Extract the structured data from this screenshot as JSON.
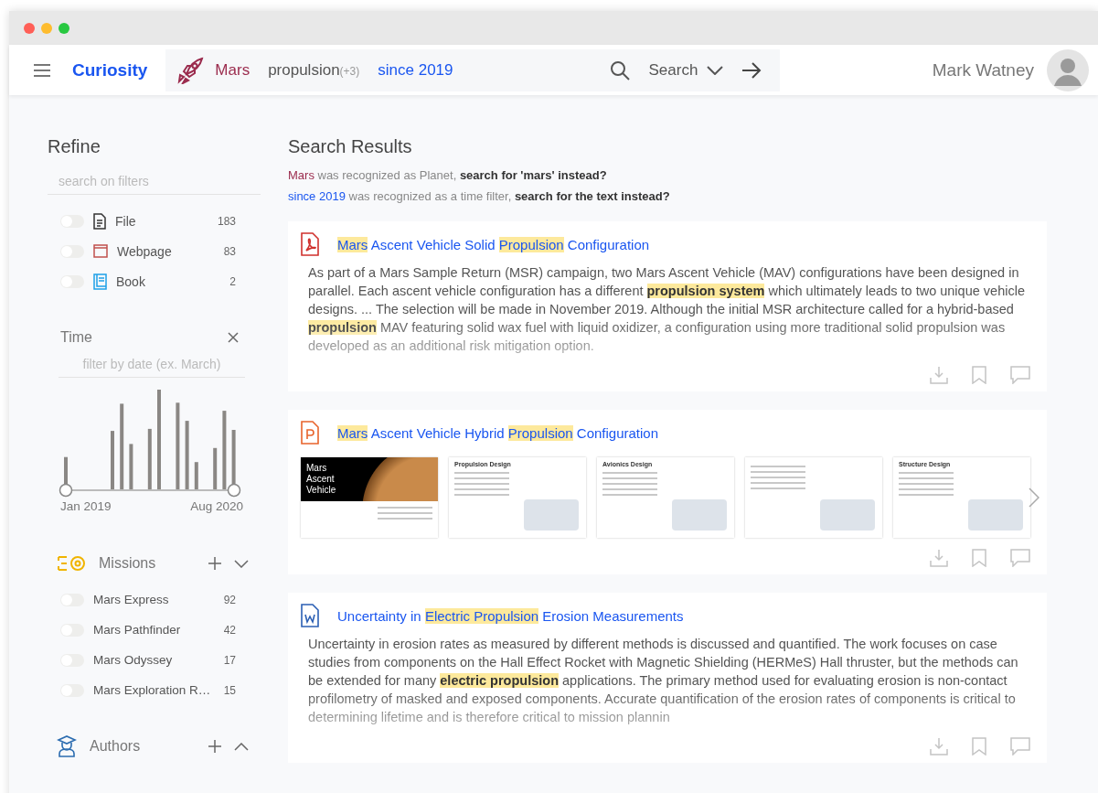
{
  "header": {
    "app_name": "Curiosity",
    "query_tokens": [
      {
        "kind": "entity",
        "text": "Mars"
      },
      {
        "kind": "term",
        "text": "propulsion",
        "extra": "(+3)"
      },
      {
        "kind": "time",
        "text": "since 2019"
      }
    ],
    "search_button": "Search",
    "user_name": "Mark Watney"
  },
  "refine": {
    "title": "Refine",
    "filter_placeholder": "search on filters",
    "types": [
      {
        "kind": "file",
        "label": "File",
        "count": "183",
        "on": false
      },
      {
        "kind": "webpage",
        "label": "Webpage",
        "count": "83",
        "on": false
      },
      {
        "kind": "book",
        "label": "Book",
        "count": "2",
        "on": false
      }
    ],
    "time": {
      "title": "Time",
      "placeholder": "filter by date (ex. March)",
      "start_label": "Jan 2019",
      "end_label": "Aug 2020"
    },
    "facets": [
      {
        "kind": "missions",
        "title": "Missions",
        "expanded": true,
        "items": [
          {
            "label": "Mars Express",
            "count": "92",
            "on": false
          },
          {
            "label": "Mars Pathfinder",
            "count": "42",
            "on": false
          },
          {
            "label": "Mars Odyssey",
            "count": "17",
            "on": false
          },
          {
            "label": "Mars Exploration R…",
            "count": "15",
            "on": false
          }
        ]
      },
      {
        "kind": "authors",
        "title": "Authors",
        "expanded": false
      }
    ]
  },
  "results": {
    "title": "Search Results",
    "notices": [
      {
        "kind": "entity",
        "entity": "Mars",
        "text": "was recognized as Planet,",
        "action": "search for 'mars' instead?"
      },
      {
        "kind": "time",
        "entity": "since 2019",
        "text": "was recognized as a time filter,",
        "action": "search for the text instead?"
      }
    ],
    "items": [
      {
        "kind": "pdf",
        "title": [
          {
            "text": "Mars",
            "hl": true
          },
          {
            "text": " Ascent Vehicle Solid ",
            "hl": false
          },
          {
            "text": "Propulsion",
            "hl": true
          },
          {
            "text": " Configuration",
            "hl": false
          }
        ],
        "snippet": [
          {
            "text": "As part of a Mars Sample Return (MSR) campaign, two Mars Ascent Vehicle (MAV) configurations have been designed in parallel. Each ascent vehicle configuration has a different ",
            "hl": false
          },
          {
            "text": "propulsion system",
            "hl": true
          },
          {
            "text": " which ultimately leads to two unique vehicle designs. ... The selection will be made in November 2019. Although the initial MSR architecture called for a hybrid-based ",
            "hl": false
          },
          {
            "text": "propulsion",
            "hl": true
          },
          {
            "text": " MAV featuring solid wax fuel with liquid oxidizer, a configuration using more traditional solid propulsion was developed as an additional risk mitigation option.",
            "hl": false
          }
        ]
      },
      {
        "kind": "ppt",
        "title": [
          {
            "text": "Mars",
            "hl": true
          },
          {
            "text": " Ascent Vehicle Hybrid ",
            "hl": false
          },
          {
            "text": "Propulsion",
            "hl": true
          },
          {
            "text": " Configuration",
            "hl": false
          }
        ],
        "slides": [
          {
            "kind": "cover",
            "title": "Mars Ascent Vehicle"
          },
          {
            "kind": "content",
            "title": "Propulsion Design"
          },
          {
            "kind": "content",
            "title": "Avionics Design"
          },
          {
            "kind": "content"
          },
          {
            "kind": "content",
            "title": "Structure Design"
          }
        ]
      },
      {
        "kind": "word",
        "title": [
          {
            "text": "Uncertainty in ",
            "hl": false
          },
          {
            "text": "Electric Propulsion",
            "hl": true
          },
          {
            "text": " Erosion Measurements",
            "hl": false
          }
        ],
        "snippet": [
          {
            "text": "Uncertainty in erosion rates as measured by different methods is discussed and quantified. The work focuses on case studies from components on the Hall Effect Rocket with Magnetic Shielding (HERMeS) Hall thruster, but the methods can be extended for many ",
            "hl": false
          },
          {
            "text": "electric propulsion",
            "hl": true
          },
          {
            "text": " applications. The primary method used for evaluating erosion is non-contact profilometry of masked and exposed components. Accurate quantification of the erosion rates of components is critical to determining lifetime and is therefore critical to mission plannin",
            "hl": false
          }
        ]
      }
    ]
  }
}
